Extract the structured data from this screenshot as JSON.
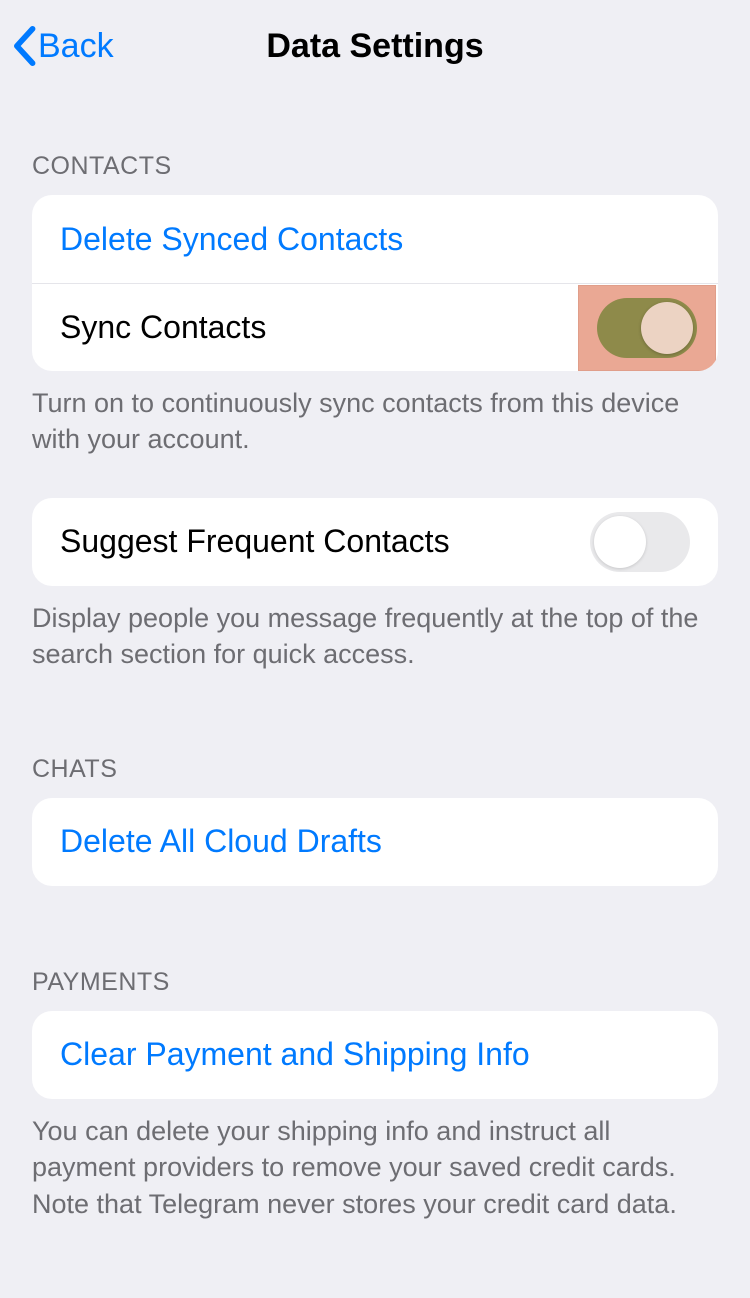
{
  "nav": {
    "back": "Back",
    "title": "Data Settings"
  },
  "sections": {
    "contacts": {
      "header": "CONTACTS",
      "delete_synced": "Delete Synced Contacts",
      "sync": "Sync Contacts",
      "sync_footer": "Turn on to continuously sync contacts from this device with your account.",
      "suggest": "Suggest Frequent Contacts",
      "suggest_footer": "Display people you message frequently at the top of the search section for quick access."
    },
    "chats": {
      "header": "CHATS",
      "delete_drafts": "Delete All Cloud Drafts"
    },
    "payments": {
      "header": "PAYMENTS",
      "clear": "Clear Payment and Shipping Info",
      "footer": "You can delete your shipping info and instruct all payment providers to remove your saved credit cards. Note that Telegram never stores your credit card data."
    }
  },
  "toggles": {
    "sync_contacts": true,
    "suggest_frequent": false
  }
}
